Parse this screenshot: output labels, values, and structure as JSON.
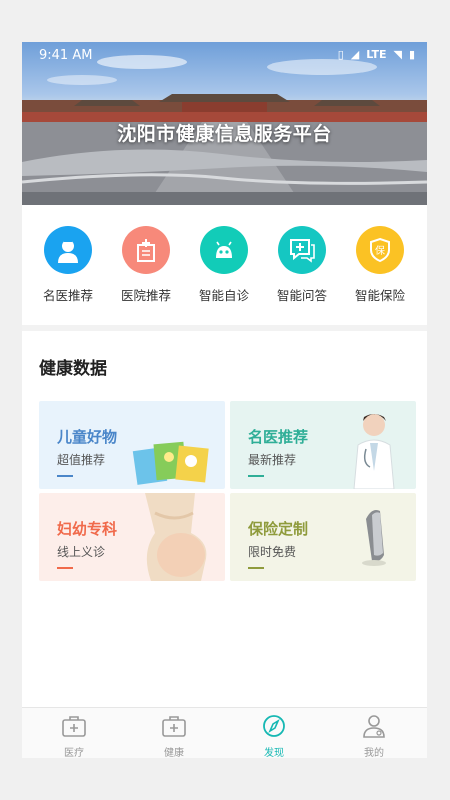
{
  "status": {
    "time": "9:41 AM",
    "network": "LTE"
  },
  "banner": {
    "title": "沈阳市健康信息服务平台"
  },
  "quick_actions": [
    {
      "label": "名医推荐",
      "icon": "doctor-icon",
      "color": "#1aa3f0"
    },
    {
      "label": "医院推荐",
      "icon": "hospital-icon",
      "color": "#f7897a"
    },
    {
      "label": "智能自诊",
      "icon": "robot-icon",
      "color": "#12ccb8"
    },
    {
      "label": "智能问答",
      "icon": "chat-plus-icon",
      "color": "#15c7c2"
    },
    {
      "label": "智能保险",
      "icon": "insurance-shield-icon",
      "color": "#fbc224"
    }
  ],
  "section": {
    "title": "健康数据"
  },
  "cards": [
    {
      "title": "儿童好物",
      "subtitle": "超值推荐",
      "title_color": "#4a86c9",
      "bg": "#e8f3fc",
      "bar_color": "#4a86c9"
    },
    {
      "title": "名医推荐",
      "subtitle": "最新推荐",
      "title_color": "#2fae97",
      "bg": "#e6f4f1",
      "bar_color": "#2fae97"
    },
    {
      "title": "妇幼专科",
      "subtitle": "线上义诊",
      "title_color": "#f06a4b",
      "bg": "#fdeeea",
      "bar_color": "#f06a4b"
    },
    {
      "title": "保险定制",
      "subtitle": "限时免费",
      "title_color": "#8f9b3c",
      "bg": "#f3f4e7",
      "bar_color": "#8f9b3c"
    }
  ],
  "tabs": [
    {
      "label": "医疗",
      "icon": "medical-kit-icon",
      "active": false
    },
    {
      "label": "健康",
      "icon": "health-kit-icon",
      "active": false
    },
    {
      "label": "发现",
      "icon": "compass-icon",
      "active": true
    },
    {
      "label": "我的",
      "icon": "user-icon",
      "active": false
    }
  ]
}
